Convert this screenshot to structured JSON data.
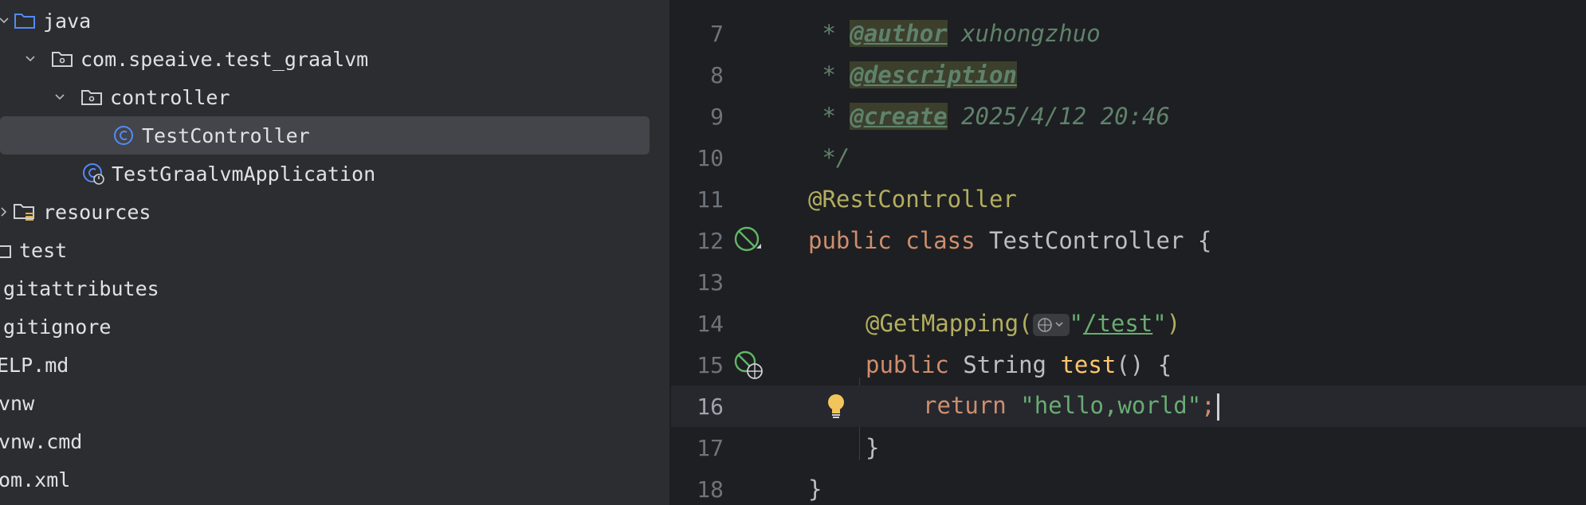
{
  "project_tree": {
    "items": [
      {
        "label": "java",
        "icon": "folder-source-icon"
      },
      {
        "label": "com.speaive.test_graalvm",
        "icon": "package-icon"
      },
      {
        "label": "controller",
        "icon": "package-icon"
      },
      {
        "label": "TestController",
        "icon": "class-icon"
      },
      {
        "label": "TestGraalvmApplication",
        "icon": "spring-boot-class-icon"
      },
      {
        "label": "resources",
        "icon": "resources-folder-icon"
      },
      {
        "label": "test",
        "icon": "folder-icon"
      },
      {
        "label": "gitattributes",
        "icon": ""
      },
      {
        "label": "gitignore",
        "icon": ""
      },
      {
        "label": "ELP.md",
        "icon": ""
      },
      {
        "label": "vnw",
        "icon": ""
      },
      {
        "label": "vnw.cmd",
        "icon": ""
      },
      {
        "label": "om.xml",
        "icon": ""
      }
    ],
    "selected": "TestController"
  },
  "editor": {
    "current_line": "16",
    "lines": [
      {
        "num": "7"
      },
      {
        "num": "8"
      },
      {
        "num": "9"
      },
      {
        "num": "10"
      },
      {
        "num": "11"
      },
      {
        "num": "12"
      },
      {
        "num": "13"
      },
      {
        "num": "14"
      },
      {
        "num": "15"
      },
      {
        "num": "16"
      },
      {
        "num": "17"
      },
      {
        "num": "18"
      }
    ],
    "tokens": {
      "l7_star": " * ",
      "l7_tag": "@author",
      "l7_text": " xuhongzhuo",
      "l8_star": " * ",
      "l8_tag": "@description",
      "l9_star": " * ",
      "l9_tag": "@create",
      "l9_text": " 2025/4/12 20:46",
      "l10_text": " */",
      "l11_ann": "@RestController",
      "l12_kw1": "public",
      "l12_kw2": "class",
      "l12_name": "TestController",
      "l12_brace": "{",
      "l14_ann": "@GetMapping(",
      "l14_str_open": "\"",
      "l14_path": "/test",
      "l14_str_close": "\"",
      "l14_close": ")",
      "l15_kw": "public",
      "l15_type": "String",
      "l15_name": "test",
      "l15_rest": "() {",
      "l16_kw": "return",
      "l16_str": "\"hello,world\"",
      "l16_semi": ";",
      "l17_brace": "}",
      "l18_brace": "}"
    }
  },
  "colors": {
    "keyword": "#cf8e6d",
    "annotation": "#b3ae60",
    "string": "#6aab73",
    "doc_comment": "#5f826b",
    "method": "#56a8f5"
  }
}
